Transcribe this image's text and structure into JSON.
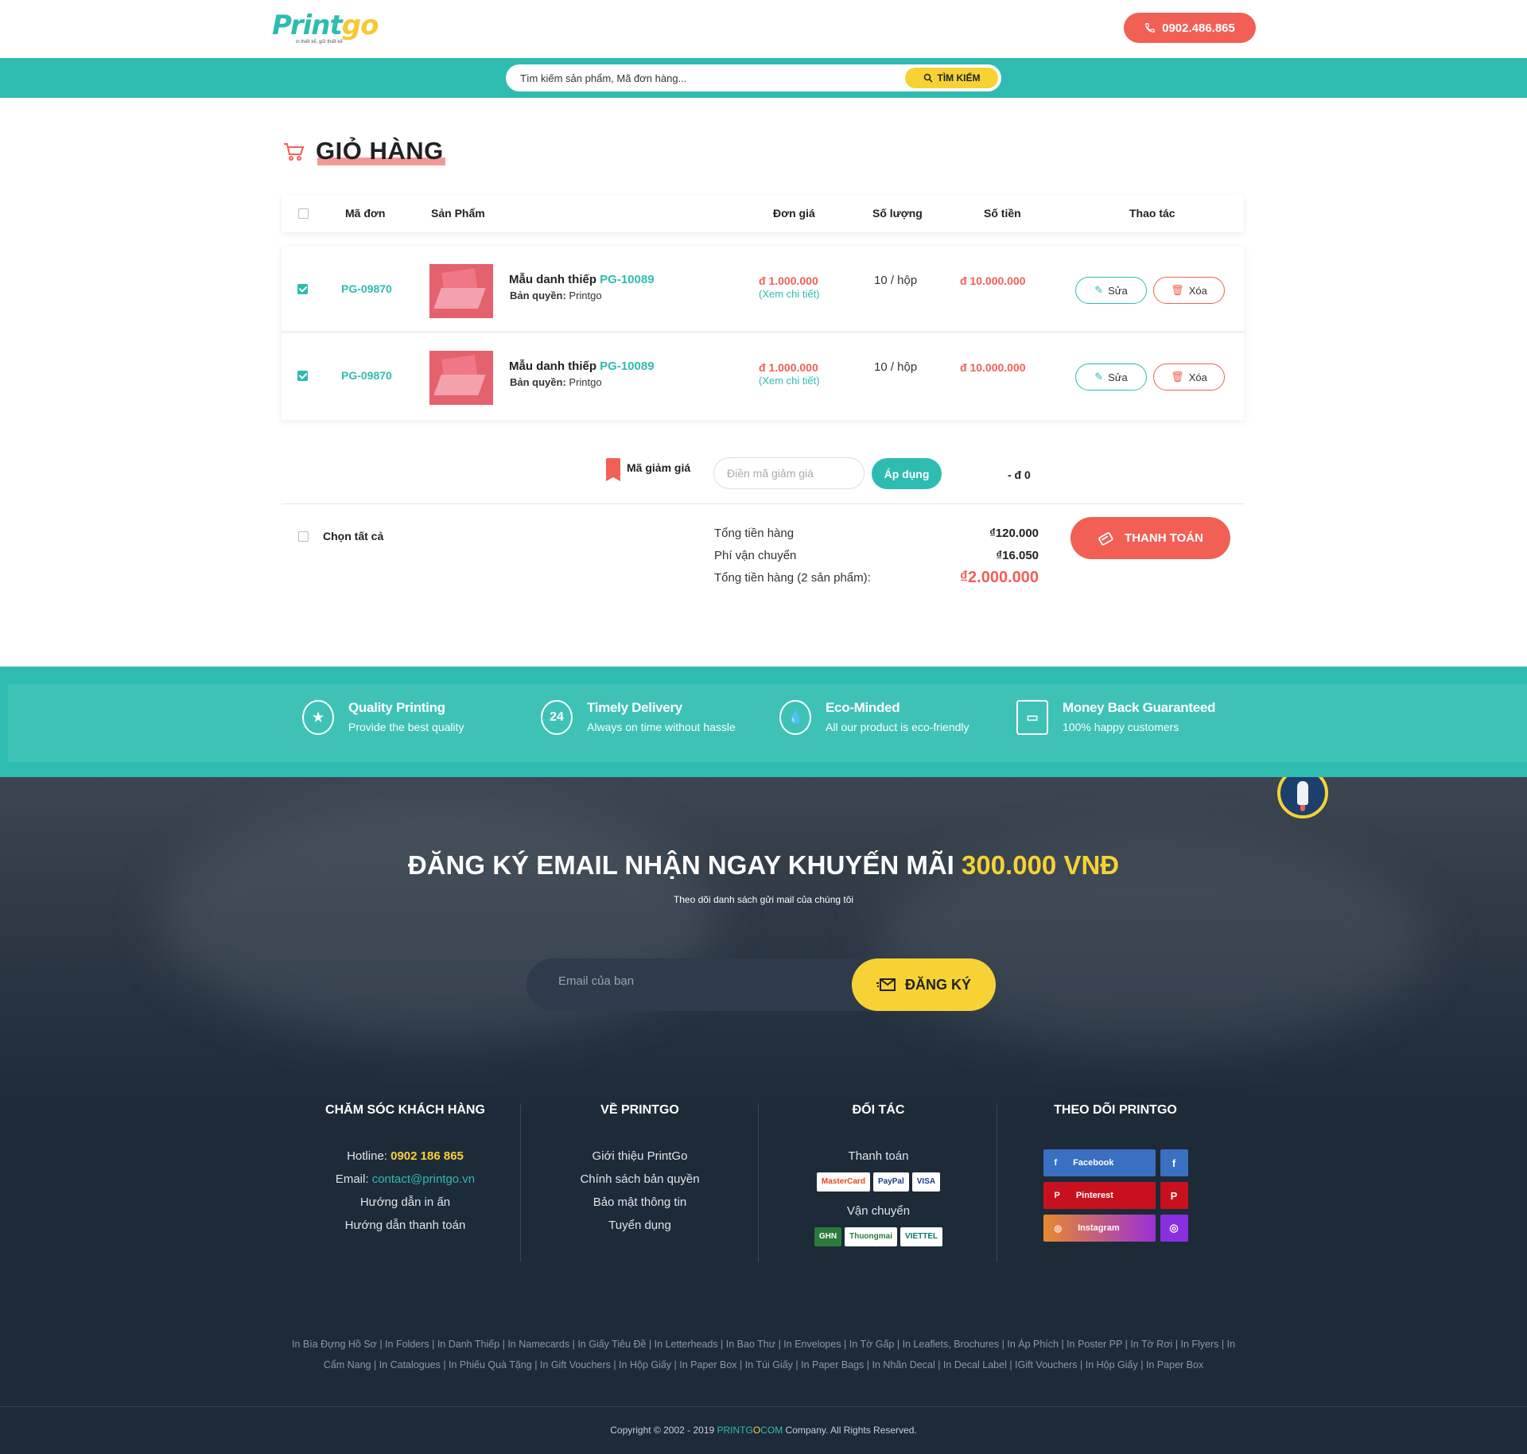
{
  "header": {
    "logo_main": "Printgo",
    "logo_tagline": "in thiết kế, giữ thiết kế",
    "phone": "0902.486.865"
  },
  "search": {
    "placeholder": "Tìm kiếm sản phẩm, Mã đơn hàng...",
    "button_label": "TÌM KIẾM"
  },
  "cart": {
    "title": "GIỎ HÀNG",
    "columns": {
      "code": "Mã đơn",
      "product": "Sản Phẩm",
      "unit_price": "Đơn giá",
      "qty": "Số lượng",
      "total": "Số tiền",
      "actions": "Thao tác"
    },
    "items": [
      {
        "checked": true,
        "order_code": "PG-09870",
        "name": "Mẫu danh thiếp",
        "product_code": "PG-10089",
        "copyright_label": "Bản quyền:",
        "copyright_value": "Printgo",
        "unit_price": "đ 1.000.000",
        "detail_link": "(Xem chi tiết)",
        "qty": "10 / hộp",
        "total": "đ 10.000.000",
        "edit_label": "Sửa",
        "delete_label": "Xóa"
      },
      {
        "checked": true,
        "order_code": "PG-09870",
        "name": "Mẫu danh thiếp",
        "product_code": "PG-10089",
        "copyright_label": "Bản quyền:",
        "copyright_value": "Printgo",
        "unit_price": "đ 1.000.000",
        "detail_link": "(Xem chi tiết)",
        "qty": "10 / hộp",
        "total": "đ 10.000.000",
        "edit_label": "Sửa",
        "delete_label": "Xóa"
      }
    ],
    "coupon": {
      "label": "Mã giảm giá",
      "placeholder": "Điền mã giảm giá",
      "apply_label": "Áp dụng",
      "discount": "- đ 0"
    },
    "select_all_label": "Chọn tất cả",
    "summary": {
      "subtotal_label": "Tổng tiền hàng",
      "subtotal_value": "₫120.000",
      "shipping_label": "Phí vận chuyển",
      "shipping_value": "₫16.050",
      "grand_label": "Tổng tiền hàng (2 sản phẩm):",
      "grand_value": "₫2.000.000"
    },
    "checkout_label": "THANH TOÁN"
  },
  "features": [
    {
      "icon": "award-icon",
      "title": "Quality Printing",
      "subtitle": "Provide the best quality"
    },
    {
      "icon": "phone-24-icon",
      "title": "Timely Delivery",
      "subtitle": "Always on time without hassle"
    },
    {
      "icon": "eco-drop-icon",
      "title": "Eco-Minded",
      "subtitle": "All our product is eco-friendly"
    },
    {
      "icon": "wallet-icon",
      "title": "Money Back Guaranteed",
      "subtitle": "100% happy customers"
    }
  ],
  "newsletter": {
    "title_main": "ĐĂNG KÝ EMAIL NHẬN NGAY KHUYẾN MÃI",
    "title_highlight": "300.000 VNĐ",
    "subtitle": "Theo dõi danh sách gửi mail của chúng tôi",
    "placeholder": "Email của bạn",
    "button_label": "ĐĂNG KÝ"
  },
  "footer": {
    "col1": {
      "title": "CHĂM SÓC KHÁCH HÀNG",
      "hotline_label": "Hotline:",
      "hotline_value": "0902 186 865",
      "email_label": "Email:",
      "email_value": "contact@printgo.vn",
      "link3": "Hướng dẫn in ấn",
      "link4": "Hướng dẫn thanh toán"
    },
    "col2": {
      "title": "VỀ PRINTGO",
      "links": [
        "Giới thiệu PrintGo",
        "Chính sách bản quyền",
        "Bảo mật thông tin",
        "Tuyển dụng"
      ]
    },
    "col3": {
      "title": "ĐỐI TÁC",
      "payment_label": "Thanh toán",
      "payment_logos": [
        "MasterCard",
        "PayPal",
        "VISA"
      ],
      "shipping_label": "Vận chuyển",
      "shipping_logos": [
        "GHN",
        "Thuongmai",
        "VIETTEL"
      ]
    },
    "col4": {
      "title": "THEO DÕI PRINTGO",
      "socials": [
        {
          "name": "Facebook",
          "glyph": "f"
        },
        {
          "name": "Pinterest",
          "glyph": "P"
        },
        {
          "name": "Instagram",
          "glyph": "◎"
        }
      ]
    },
    "link_cloud": "In Bìa Đựng Hồ Sơ | In Folders | In Danh Thiếp | In Namecards | In Giấy Tiêu Đề | In Letterheads | In Bao Thư | In Envelopes | In Tờ Gấp | In Leaflets, Brochures | In Áp Phích | In Poster PP | In Tờ Rơi | In Flyers | In Cẩm Nang | In Catalogues | In Phiếu Quà Tặng | In Gift Vouchers | In Hộp Giấy | In Paper Box | In Túi Giấy | In Paper Bags | In Nhãn Decal | In Decal Label | IGift Vouchers | In Hộp Giấy | In Paper Box",
    "copyright_prefix": "Copyright © 2002 - 2019",
    "copyright_brand_a": "PRINTG",
    "copyright_brand_b": "O",
    "copyright_brand_c": "COM",
    "copyright_suffix": "Company. All Rights Reserved."
  }
}
